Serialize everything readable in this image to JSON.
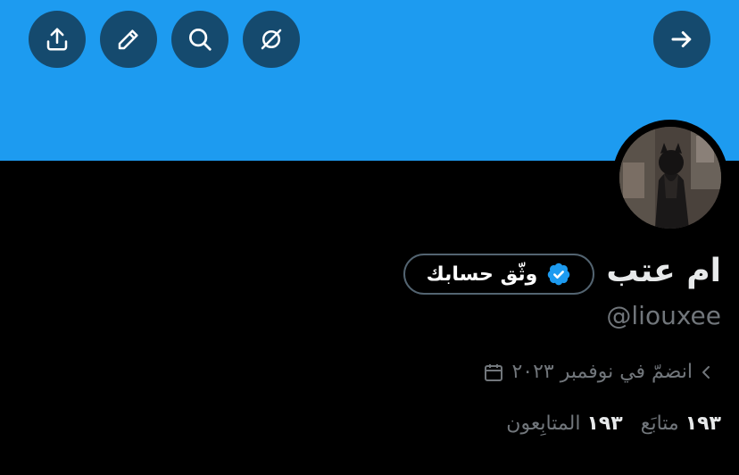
{
  "header": {
    "icons": [
      "share-icon",
      "edit-icon",
      "search-icon",
      "hide-icon",
      "forward-arrow-icon"
    ],
    "banner_color": "#1d9bf0",
    "button_color": "#154a6e"
  },
  "profile": {
    "name": "ام عتب",
    "verify_label": "وثّق حسابك",
    "handle": "@liouxee",
    "joined": "انضمّ في نوفمبر ٢٠٢٣",
    "following_count": "١٩٣",
    "following_label": "متابَع",
    "followers_count": "١٩٣",
    "followers_label": "المتابِعون"
  },
  "colors": {
    "verified": "#1d9bf0",
    "text": "#e7e9ea",
    "muted": "#71767b"
  }
}
